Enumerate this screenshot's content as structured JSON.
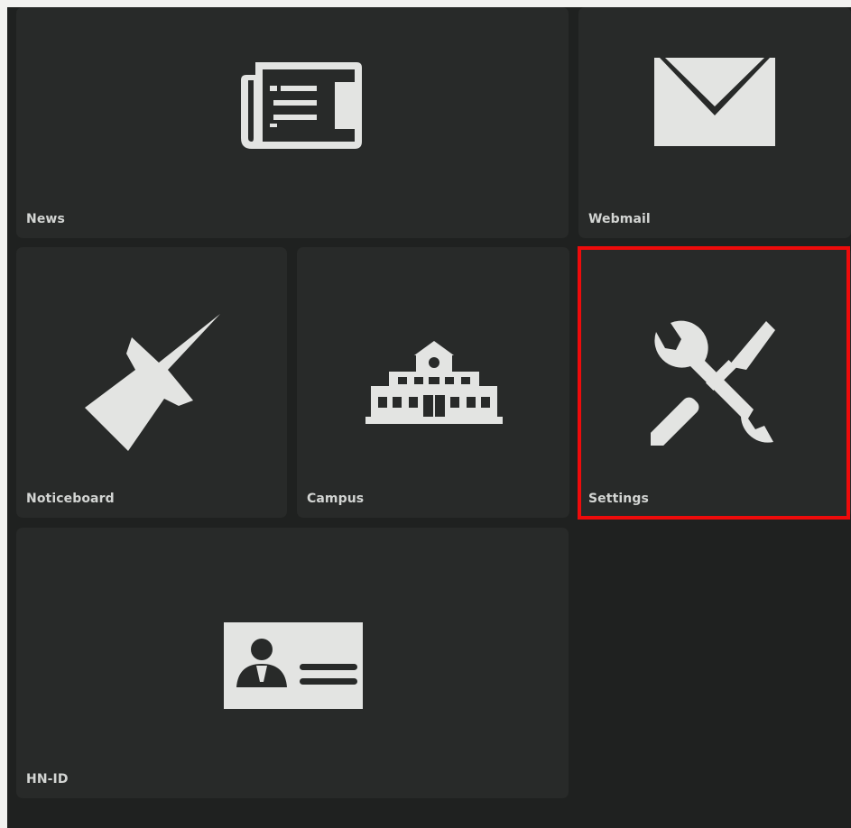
{
  "tiles": {
    "news": {
      "label": "News",
      "icon": "newspaper-icon"
    },
    "webmail": {
      "label": "Webmail",
      "icon": "envelope-icon"
    },
    "noticeboard": {
      "label": "Noticeboard",
      "icon": "pushpin-icon"
    },
    "campus": {
      "label": "Campus",
      "icon": "building-icon"
    },
    "settings": {
      "label": "Settings",
      "icon": "wrench-screwdriver-icon",
      "highlighted": true
    },
    "hnid": {
      "label": "HN-ID",
      "icon": "id-card-icon"
    }
  },
  "colors": {
    "background": "#1f2120",
    "tile": "#282a29",
    "icon": "#e3e4e2",
    "label": "#d3d5d3",
    "highlight": "#ee0b0b"
  }
}
